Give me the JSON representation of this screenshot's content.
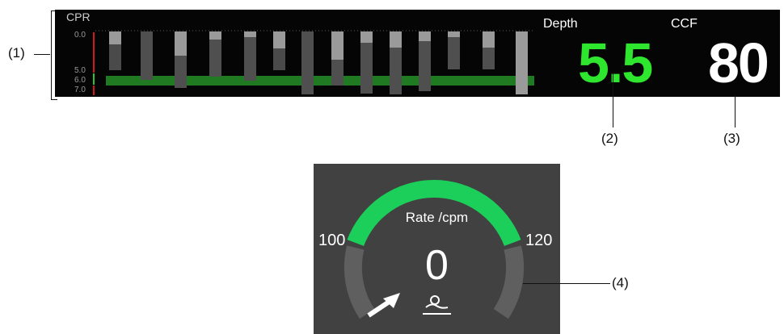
{
  "callouts": {
    "c1": "(1)",
    "c2": "(2)",
    "c3": "(3)",
    "c4": "(4)"
  },
  "cpr": {
    "title": "CPR",
    "scale": [
      "0.0",
      "5.0",
      "6.0",
      "7.0"
    ],
    "depth_label": "Depth",
    "depth_value": "5.5",
    "ccf_label": "CCF",
    "ccf_value": "80"
  },
  "gauge": {
    "title": "Rate /cpm",
    "min_label": "100",
    "max_label": "120",
    "value": "0"
  },
  "colors": {
    "depth": "#2ee62e",
    "ccf": "#ffffff",
    "target_band": "#1f7a22",
    "gauge_target": "#1ccf5a",
    "gauge_track": "#5f5f5f",
    "panel": "#050505",
    "gauge_panel": "#414141"
  },
  "icons": [
    "cpr-person-icon",
    "pointer-arrow-icon"
  ]
}
